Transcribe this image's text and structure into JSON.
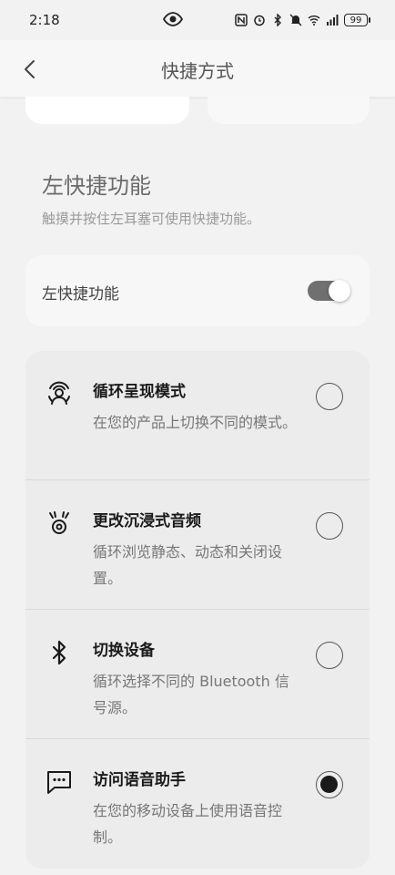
{
  "status": {
    "time": "2:18",
    "battery": "99"
  },
  "header": {
    "title": "快捷方式"
  },
  "section": {
    "title": "左快捷功能",
    "description": "触摸并按住左耳塞可使用快捷功能。"
  },
  "toggle_row": {
    "label": "左快捷功能",
    "enabled": true
  },
  "options": [
    {
      "icon": "person-focus-icon",
      "title": "循环呈现模式",
      "description": "在您的产品上切换不同的模式。",
      "selected": false
    },
    {
      "icon": "immersive-audio-icon",
      "title": "更改沉浸式音频",
      "description": "循环浏览静态、动态和关闭设置。",
      "selected": false
    },
    {
      "icon": "bluetooth-icon",
      "title": "切换设备",
      "description": "循环选择不同的 Bluetooth 信号源。",
      "selected": true,
      "selected_value": false
    },
    {
      "icon": "chat-bubble-icon",
      "title": "访问语音助手",
      "description": "在您的移动设备上使用语音控制。",
      "selected": true
    }
  ]
}
